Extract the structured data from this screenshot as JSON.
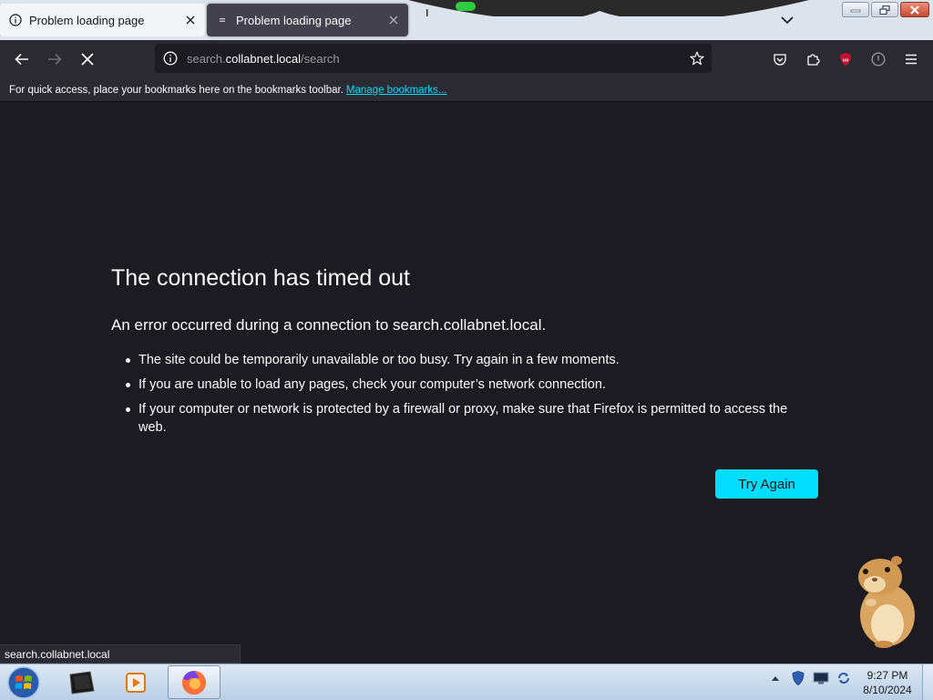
{
  "tabs": [
    {
      "title": "Problem loading page",
      "icon": "info-icon",
      "active": false
    },
    {
      "title": "Problem loading page",
      "icon": "loading-icon",
      "active": true
    }
  ],
  "urlbar": {
    "prefix": "search.",
    "host": "collabnet.local",
    "path": "/search"
  },
  "bookmarks_toolbar": {
    "message": "For quick access, place your bookmarks here on the bookmarks toolbar.",
    "link_label": "Manage bookmarks..."
  },
  "error_page": {
    "title": "The connection has timed out",
    "description": "An error occurred during a connection to search.collabnet.local.",
    "items": [
      "The site could be temporarily unavailable or too busy. Try again in a few moments.",
      "If you are unable to load any pages, check your computer’s network connection.",
      "If your computer or network is protected by a firewall or proxy, make sure that Firefox is permitted to access the web."
    ],
    "button_label": "Try Again"
  },
  "status_tooltip": "search.collabnet.local",
  "taskbar": {
    "items": [
      "terminal-icon",
      "media-player-icon",
      "firefox-icon"
    ],
    "tray_icons": [
      "show-hidden-icons",
      "shield-icon",
      "network-icon",
      "sync-icon"
    ],
    "clock_time": "9:27 PM",
    "clock_date": "8/10/2024"
  },
  "colors": {
    "accent": "#00ddff",
    "content_bg": "#1c1b22",
    "toolbar_bg": "#2b2a33",
    "tabstrip_bg": "#dde3ec"
  }
}
